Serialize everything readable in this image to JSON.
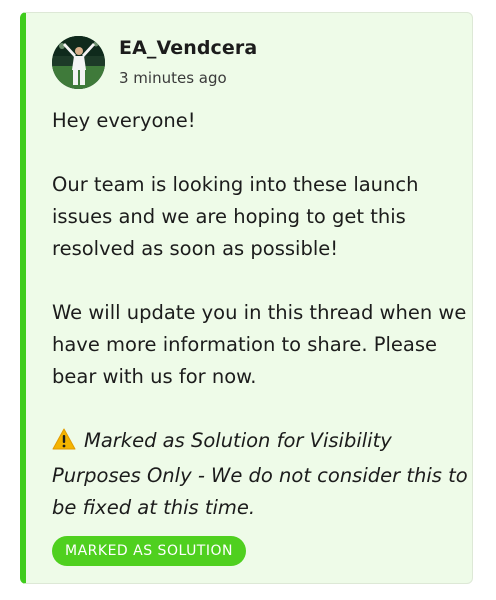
{
  "post": {
    "author": "EA_Vendcera",
    "timestamp": "3 minutes ago",
    "avatar_icon": "avatar-icon",
    "paragraphs": [
      "Hey everyone!",
      "Our team is looking into these launch issues and we are hoping to get this resolved as soon as possible!",
      "We will update you in this thread when we have more information to share. Please bear with us for now."
    ],
    "note_icon": "warning-icon",
    "note": "Marked as Solution for Visibility Purposes Only - We do not consider this to be fixed at this time.",
    "badge_label": "MARKED AS SOLUTION"
  },
  "colors": {
    "accent": "#3fcc1c",
    "card_background": "#eefbe8",
    "badge_background": "#4fd01f"
  }
}
